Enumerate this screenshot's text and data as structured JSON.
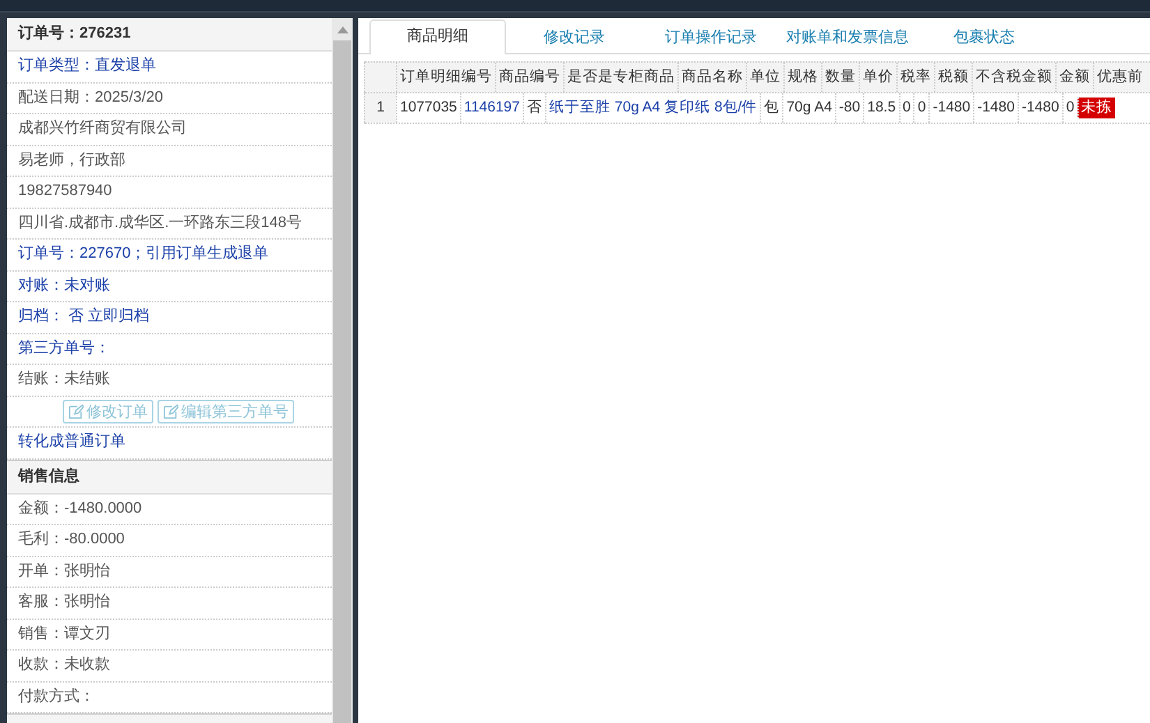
{
  "left_panel": {
    "title": "订单号：276231",
    "rows": [
      {
        "kind": "link",
        "text": "订单类型：直发退单"
      },
      {
        "kind": "plain",
        "text": "配送日期：2025/3/20"
      },
      {
        "kind": "plain",
        "text": "成都兴竹纤商贸有限公司"
      },
      {
        "kind": "plain",
        "text": "易老师，行政部"
      },
      {
        "kind": "plain",
        "text": "19827587940"
      },
      {
        "kind": "plain",
        "text": "四川省.成都市.成华区.一环路东三段148号"
      },
      {
        "kind": "link",
        "text": "订单号：227670；引用订单生成退单"
      },
      {
        "kind": "link",
        "text": "对账：未对账"
      },
      {
        "kind": "link",
        "text": "归档： 否 立即归档"
      },
      {
        "kind": "link",
        "text": "第三方单号："
      },
      {
        "kind": "plain",
        "text": "结账：未结账"
      },
      {
        "kind": "buttons",
        "buttons": [
          {
            "label": "修改订单",
            "disabled": true
          },
          {
            "label": "编辑第三方单号",
            "disabled": true
          }
        ]
      },
      {
        "kind": "link",
        "text": "转化成普通订单"
      }
    ],
    "sales_title": "销售信息",
    "sales_rows": [
      "金额：-1480.0000",
      "毛利：-80.0000",
      "开单：张明怡",
      "客服：张明怡",
      "销售：谭文刃",
      "收款：未收款",
      "付款方式："
    ]
  },
  "tabs": [
    {
      "label": "商品明细",
      "selected": true
    },
    {
      "label": "修改记录",
      "selected": false
    },
    {
      "label": "订单操作记录",
      "selected": false
    },
    {
      "label": "对账单和发票信息",
      "selected": false
    },
    {
      "label": "包裹状态",
      "selected": false
    }
  ],
  "detail_list": {
    "header_strip": [
      "订单明细编号",
      "商品编号",
      "是否是专柜商品",
      "商品名称",
      "单位",
      "规格",
      "数量",
      "单价",
      "税率",
      "税额",
      "不含税金额",
      "金额",
      "优惠前"
    ],
    "item_strips": [
      [
        {
          "kind": "index",
          "text": "1"
        },
        {
          "kind": "plain",
          "text": "1077035"
        },
        {
          "kind": "link",
          "text": "1146197"
        },
        {
          "kind": "plain",
          "text": "否"
        },
        {
          "kind": "link",
          "text": "纸于至胜 70g A4 复印纸 8包/件"
        },
        {
          "kind": "plain",
          "text": "包"
        },
        {
          "kind": "plain",
          "text": "70g A4"
        },
        {
          "kind": "plain",
          "text": "-80"
        },
        {
          "kind": "plain",
          "text": "18.5"
        },
        {
          "kind": "plain",
          "text": "0"
        },
        {
          "kind": "plain",
          "text": "0"
        },
        {
          "kind": "plain",
          "text": "-1480"
        },
        {
          "kind": "plain",
          "text": "-1480"
        },
        {
          "kind": "plain",
          "text": "-1480"
        },
        {
          "kind": "plain",
          "text": "0"
        },
        {
          "kind": "badge",
          "text": "未拣"
        }
      ]
    ]
  }
}
